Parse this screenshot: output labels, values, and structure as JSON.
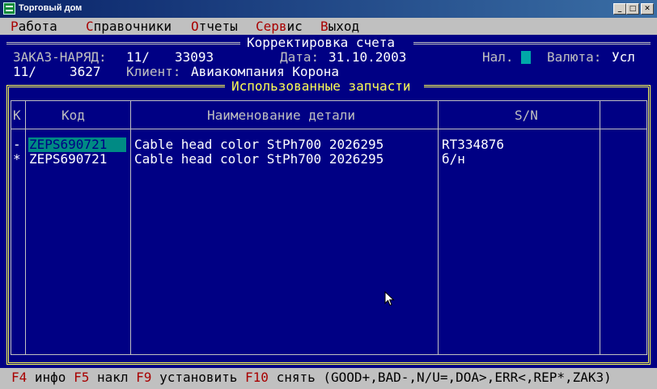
{
  "window": {
    "title": "Торговый дом",
    "controls": {
      "minimize": "_",
      "maximize": "□",
      "close": "✕"
    }
  },
  "menu": [
    "Работа",
    "Справочники",
    "Отчеты",
    "Сервис",
    "Выход"
  ],
  "form": {
    "title": "Корректировка счета",
    "order_label": "ЗАКАЗ-НАРЯД:",
    "order_prefix": "11/",
    "order_number": "33093",
    "date_label": "Дата:",
    "date_value": "31.10.2003",
    "nal_label": "Нал.",
    "currency_label": "Валюта:",
    "currency_value": "Усл",
    "line2_prefix": "11/",
    "line2_number": "3627",
    "client_label": "Клиент:",
    "client_value": "Авиакомпания Корона"
  },
  "parts": {
    "title": "Использованные запчасти",
    "columns": [
      "К",
      "Код",
      "Наименование детали",
      "S/N"
    ],
    "rows": [
      {
        "mark": "-",
        "code": "ZEPS690721",
        "name": "Cable head color StPh700 2026295",
        "sn": "RT334876"
      },
      {
        "mark": "*",
        "code": "ZEPS690721",
        "name": "Cable head color StPh700 2026295",
        "sn": "б/н"
      }
    ]
  },
  "fkeys": {
    "f4": "F4",
    "f4_label": "инфо",
    "f5": "F5",
    "f5_label": "накл",
    "f9": "F9",
    "f9_label": "установить",
    "f10": "F10",
    "f10_label": "снять",
    "legend": "(GOOD+,BAD-,N/U=,DOA>,ERR<,REP*,ZAK3)"
  },
  "colors": {
    "screen_bg": "#000084",
    "highlight_bg": "#008a84",
    "yellow_text": "#ffff54",
    "hotkey_red": "#a80000"
  },
  "icons": [
    "app-icon",
    "minimize-icon",
    "maximize-icon",
    "close-icon",
    "mouse-cursor-icon"
  ]
}
